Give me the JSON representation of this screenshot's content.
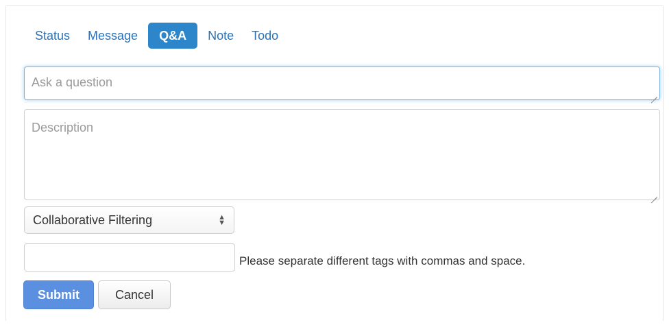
{
  "tabs": [
    {
      "label": "Status",
      "active": false
    },
    {
      "label": "Message",
      "active": false
    },
    {
      "label": "Q&A",
      "active": true
    },
    {
      "label": "Note",
      "active": false
    },
    {
      "label": "Todo",
      "active": false
    }
  ],
  "form": {
    "question_placeholder": "Ask a question",
    "question_value": "",
    "description_placeholder": "Description",
    "description_value": "",
    "category_selected": "Collaborative Filtering",
    "tags_value": "",
    "tags_help": "Please separate different tags with commas and space.",
    "submit_label": "Submit",
    "cancel_label": "Cancel"
  },
  "icons": {
    "select_arrows": "select-arrows-icon",
    "resize_grip": "resize-grip-icon"
  },
  "colors": {
    "tab_text": "#2a72b5",
    "tab_active_bg": "#2d86c9",
    "submit_bg": "#5b8fdf",
    "focus_border": "#7bb3e6"
  }
}
